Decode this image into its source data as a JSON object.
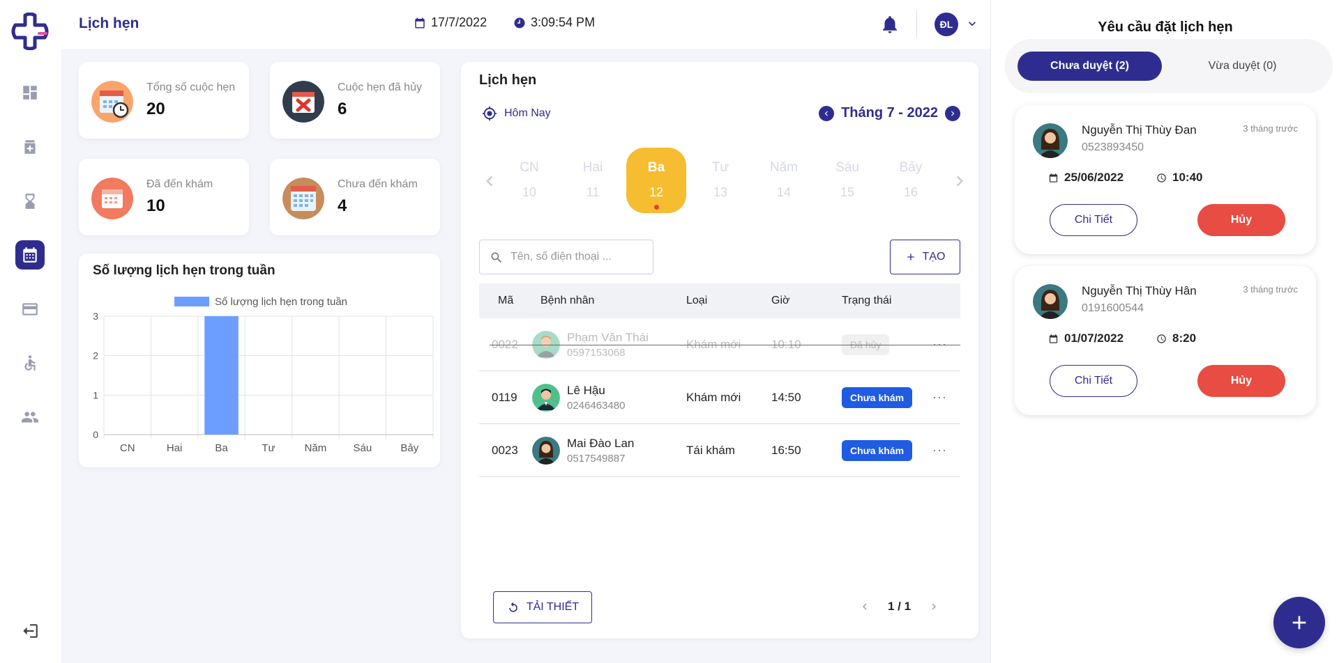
{
  "app": {
    "page_title": "Lịch hẹn"
  },
  "topbar": {
    "date": "17/7/2022",
    "time": "3:09:54 PM",
    "user_initials": "ĐL",
    "icons": [
      "calendar-icon",
      "clock-icon",
      "bell-icon",
      "chevron-down-icon"
    ]
  },
  "sidebar": {
    "items": [
      {
        "name": "dashboard",
        "icon": "dashboard-icon",
        "active": false
      },
      {
        "name": "medicine",
        "icon": "medicine-icon",
        "active": false
      },
      {
        "name": "hourglass",
        "icon": "hourglass-icon",
        "active": false
      },
      {
        "name": "appointments",
        "icon": "calendar-icon",
        "active": true
      },
      {
        "name": "payment",
        "icon": "credit-card-icon",
        "active": false
      },
      {
        "name": "patients",
        "icon": "accessible-icon",
        "active": false
      },
      {
        "name": "staff",
        "icon": "people-icon",
        "active": false
      }
    ],
    "logout_icon": "logout-icon"
  },
  "stats": [
    {
      "label": "Tổng số cuộc hẹn",
      "value": "20"
    },
    {
      "label": "Cuộc hẹn đã hủy",
      "value": "6"
    },
    {
      "label": "Đã đến khám",
      "value": "10"
    },
    {
      "label": "Chưa đến khám",
      "value": "4"
    }
  ],
  "chart_data": {
    "type": "bar",
    "title": "Số lượng lịch hẹn trong tuần",
    "categories": [
      "CN",
      "Hai",
      "Ba",
      "Tư",
      "Năm",
      "Sáu",
      "Bảy"
    ],
    "series": [
      {
        "name": "Số lượng lịch hẹn trong tuần",
        "values": [
          0,
          0,
          3,
          0,
          0,
          0,
          0
        ]
      }
    ],
    "ylim": [
      0,
      3
    ],
    "yticks": [
      "0",
      "1",
      "2",
      "3"
    ],
    "grid": true,
    "legend": "top-center",
    "color": "#6b9eff"
  },
  "appointments": {
    "title": "Lịch hẹn",
    "today_label": "Hôm Nay",
    "month_label": "Tháng 7 - 2022",
    "week": [
      {
        "name": "CN",
        "num": "10",
        "active": false
      },
      {
        "name": "Hai",
        "num": "11",
        "active": false
      },
      {
        "name": "Ba",
        "num": "12",
        "active": true
      },
      {
        "name": "Tư",
        "num": "13",
        "active": false
      },
      {
        "name": "Năm",
        "num": "14",
        "active": false
      },
      {
        "name": "Sáu",
        "num": "15",
        "active": false
      },
      {
        "name": "Bảy",
        "num": "16",
        "active": false
      }
    ],
    "search_placeholder": "Tên, số điện thoại ...",
    "create_label": "TẠO",
    "columns": {
      "code": "Mã",
      "patient": "Bệnh nhân",
      "type": "Loại",
      "hour": "Giờ",
      "status": "Trạng thái"
    },
    "rows": [
      {
        "code": "0022",
        "name": "Phạm Văn Thái",
        "phone": "0597153068",
        "type": "Khám mới",
        "hour": "10:10",
        "status": "Đã hủy",
        "cancelled": true
      },
      {
        "code": "0119",
        "name": "Lê Hậu",
        "phone": "0246463480",
        "type": "Khám mới",
        "hour": "14:50",
        "status": "Chưa khám",
        "cancelled": false
      },
      {
        "code": "0023",
        "name": "Mai Đào Lan",
        "phone": "0517549887",
        "type": "Tái khám",
        "hour": "16:50",
        "status": "Chưa khám",
        "cancelled": false
      }
    ],
    "more_glyph": "···",
    "reset_label": "TẢI THIẾT",
    "pager": "1 / 1"
  },
  "requests": {
    "title": "Yêu cầu đặt lịch hẹn",
    "tab_pending": "Chưa duyệt (2)",
    "tab_approved": "Vừa duyệt (0)",
    "items": [
      {
        "name": "Nguyễn Thị Thùy Đan",
        "phone": "0523893450",
        "ago": "3 tháng trước",
        "date": "25/06/2022",
        "time": "10:40",
        "detail_label": "Chi Tiết",
        "cancel_label": "Hủy"
      },
      {
        "name": "Nguyễn Thị Thùy Hân",
        "phone": "0191600544",
        "ago": "3 tháng trước",
        "date": "01/07/2022",
        "time": "8:20",
        "detail_label": "Chi Tiết",
        "cancel_label": "Hủy"
      }
    ]
  },
  "colors": {
    "primary": "#2e2d8f",
    "accent": "#f6bd31",
    "danger": "#e94c42",
    "badge": "#1f5be3",
    "bar": "#6b9eff"
  }
}
